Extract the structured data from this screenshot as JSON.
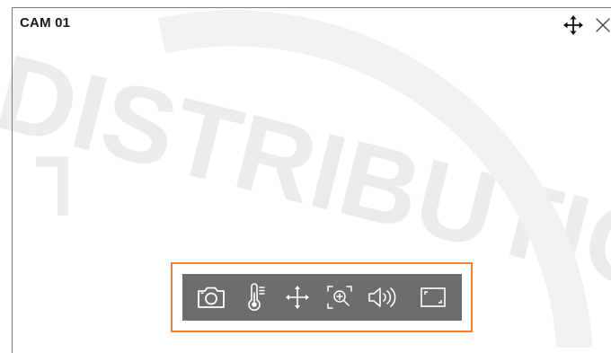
{
  "panel": {
    "title": "CAM 01"
  },
  "watermark_text": "DISTRIBUTION",
  "toolbar": {
    "items": [
      {
        "icon": "camera-capture-icon"
      },
      {
        "icon": "thermometer-icon"
      },
      {
        "icon": "move-arrows-icon"
      },
      {
        "icon": "zoom-in-icon"
      },
      {
        "icon": "audio-speaker-icon"
      },
      {
        "icon": "fullscreen-icon"
      }
    ]
  },
  "colors": {
    "highlight": "#ed7d31",
    "toolbar_bg": "#6d6d6d",
    "toolbar_icon": "#ffffff",
    "title": "#1a1a1a"
  }
}
